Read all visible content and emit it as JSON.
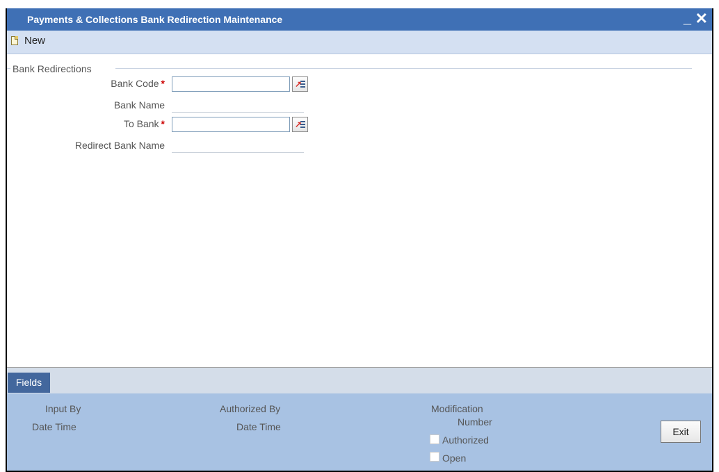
{
  "window": {
    "title": "Payments & Collections Bank Redirection Maintenance",
    "minimize_label": "_",
    "close_label": "✕"
  },
  "toolbar": {
    "new_label": "New",
    "new_icon": "new-document-icon"
  },
  "section": {
    "title": "Bank Redirections"
  },
  "form": {
    "bank_code": {
      "label": "Bank Code",
      "required_mark": "*",
      "value": ""
    },
    "bank_name": {
      "label": "Bank Name",
      "value": ""
    },
    "to_bank": {
      "label": "To Bank",
      "required_mark": "*",
      "value": ""
    },
    "redirect_bank_name": {
      "label": "Redirect Bank Name",
      "value": ""
    }
  },
  "footer": {
    "tab_label": "Fields",
    "input_by_label": "Input By",
    "date_time_label_1": "Date Time",
    "authorized_by_label": "Authorized By",
    "date_time_label_2": "Date Time",
    "modification_label": "Modification",
    "number_label": "Number",
    "authorized_checkbox_label": "Authorized",
    "open_checkbox_label": "Open",
    "exit_label": "Exit"
  },
  "colors": {
    "titlebar": "#3f70b5",
    "toolbar": "#d4e0f2",
    "audit_panel": "#a8c2e3",
    "fields_tab": "#43679d",
    "required": "#cc0000"
  }
}
